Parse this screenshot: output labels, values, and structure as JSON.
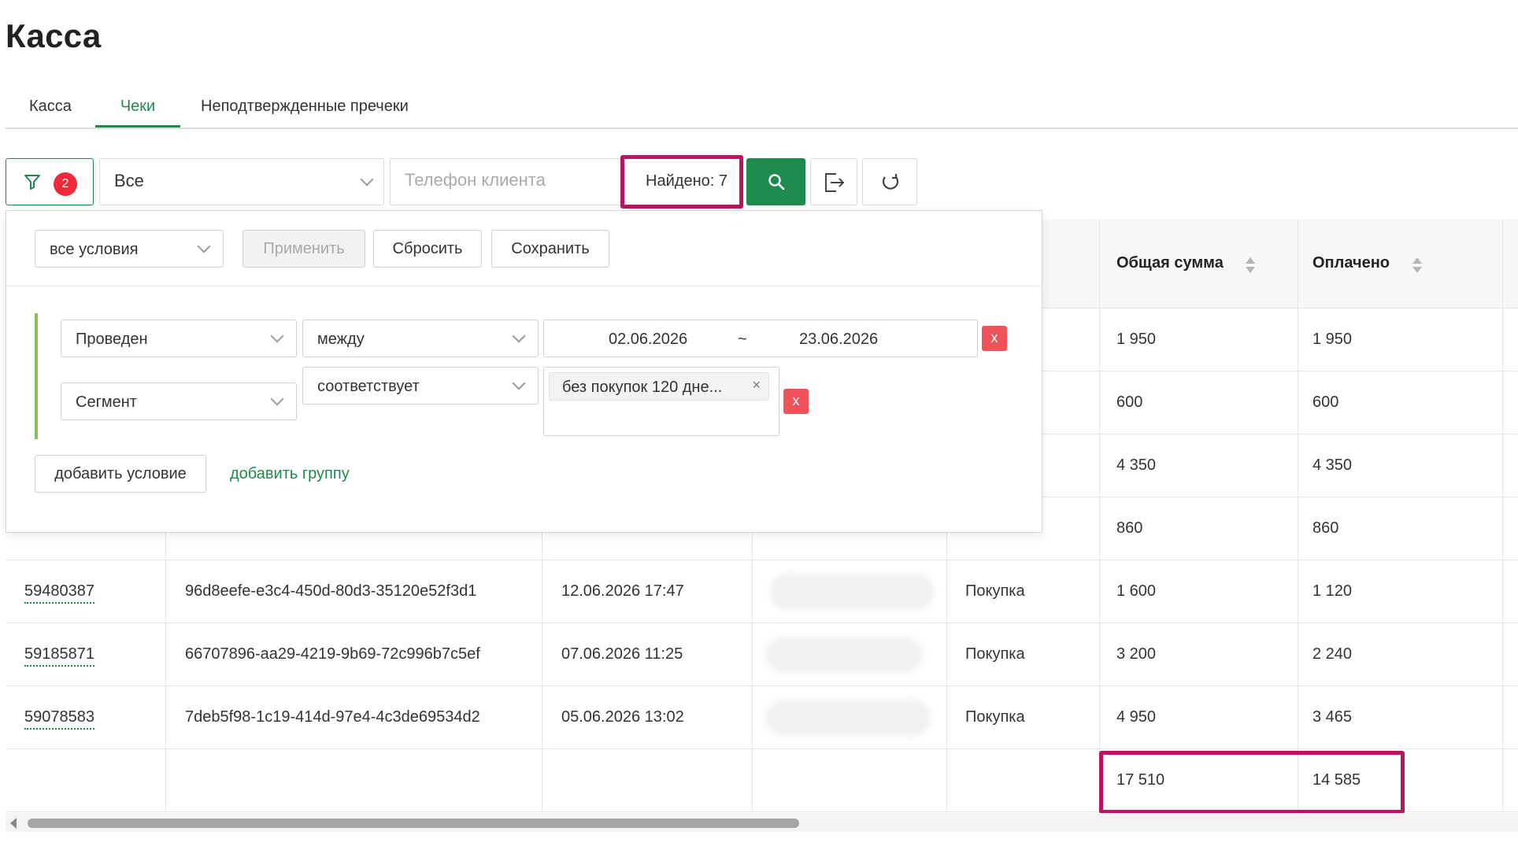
{
  "page": {
    "title": "Касса"
  },
  "tabs": [
    {
      "label": "Касса",
      "active": false
    },
    {
      "label": "Чеки",
      "active": true
    },
    {
      "label": "Неподтвержденные пречеки",
      "active": false
    }
  ],
  "toolbar": {
    "filter_count": "2",
    "select_value": "Все",
    "phone_placeholder": "Телефон клиента",
    "found_label": "Найдено: 7"
  },
  "table": {
    "columns": [
      {
        "label": "Общая сумма",
        "sortable": true
      },
      {
        "label": "Оплачено",
        "sortable": true
      }
    ],
    "rows": [
      {
        "total": "1 950",
        "paid": "1 950"
      },
      {
        "total": "600",
        "paid": "600"
      },
      {
        "total": "4 350",
        "paid": "4 350"
      },
      {
        "total": "860",
        "paid": "860"
      },
      {
        "id": "59480387",
        "guid": "96d8eefe-e3c4-450d-80d3-35120e52f3d1",
        "date": "12.06.2026 17:47",
        "type": "Покупка",
        "total": "1 600",
        "paid": "1 120"
      },
      {
        "id": "59185871",
        "guid": "66707896-aa29-4219-9b69-72c996b7c5ef",
        "date": "07.06.2026 11:25",
        "type": "Покупка",
        "total": "3 200",
        "paid": "2 240"
      },
      {
        "id": "59078583",
        "guid": "7deb5f98-1c19-414d-97e4-4c3de69534d2",
        "date": "05.06.2026 13:02",
        "type": "Покупка",
        "total": "4 950",
        "paid": "3 465"
      }
    ],
    "totals": {
      "total": "17 510",
      "paid": "14 585"
    }
  },
  "filter_panel": {
    "mode_select": "все условия",
    "apply_label": "Применить",
    "reset_label": "Сбросить",
    "save_label": "Сохранить",
    "conditions": [
      {
        "field": "Проведен",
        "operator": "между",
        "date_from": "02.06.2026",
        "date_sep": "~",
        "date_to": "23.06.2026",
        "delete_label": "x"
      },
      {
        "field": "Сегмент",
        "operator": "соответствует",
        "tag": "без покупок 120 дне...",
        "tag_remove": "×",
        "delete_label": "x"
      }
    ],
    "add_condition_label": "добавить условие",
    "add_group_label": "добавить группу"
  },
  "colors": {
    "accent": "#1e8a4c",
    "highlight": "#b5165f",
    "danger": "#f0525a",
    "badge": "#ee2a3a"
  },
  "icons": [
    "funnel-icon",
    "search-icon",
    "export-icon",
    "refresh-icon",
    "chevron-down-icon",
    "sort-icon"
  ]
}
